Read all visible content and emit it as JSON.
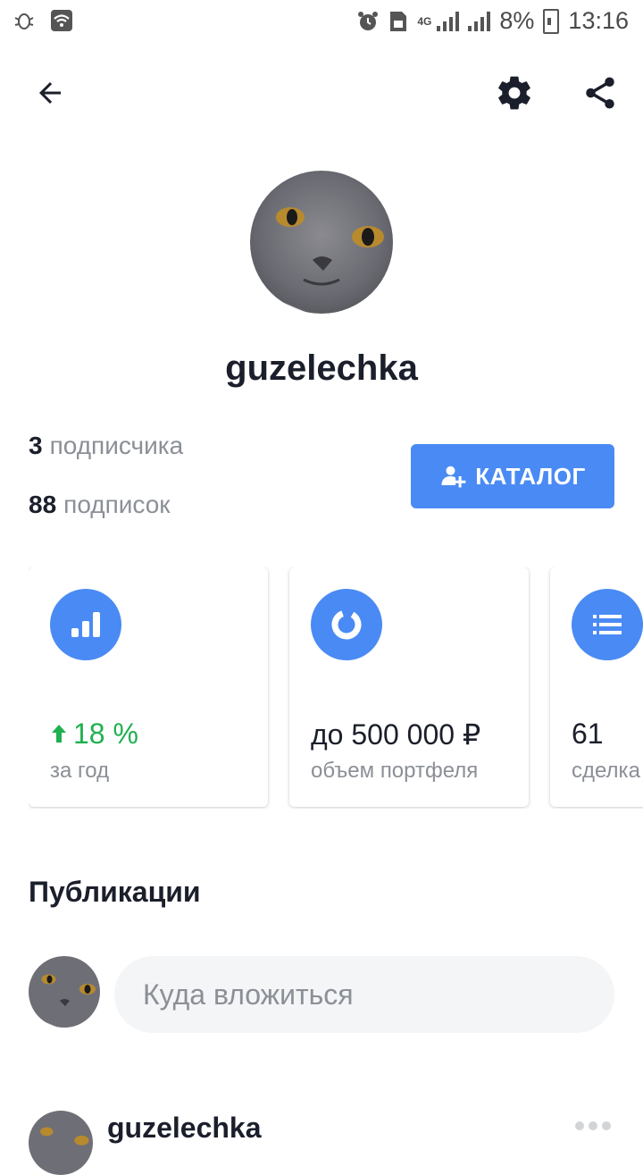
{
  "status_bar": {
    "battery": "8%",
    "time": "13:16",
    "network": "4G",
    "icons": [
      "debug-icon",
      "wifi-icon",
      "alarm-icon",
      "sim-icon",
      "signal-icon",
      "battery-icon"
    ]
  },
  "toolbar": {
    "icons": [
      "back-arrow-icon",
      "gear-icon",
      "share-icon"
    ]
  },
  "profile": {
    "username": "guzelechka",
    "followers_count": "3",
    "followers_label": "подписчика",
    "following_count": "88",
    "following_label": "подписок",
    "catalog_label": "КАТАЛОГ"
  },
  "stats": [
    {
      "icon": "bar-chart-icon",
      "value": "18 %",
      "label": "за год",
      "trend": "up"
    },
    {
      "icon": "donut-chart-icon",
      "value": "до 500 000 ₽",
      "label": "объем портфеля"
    },
    {
      "icon": "list-icon",
      "value": "61",
      "label": "сделка"
    }
  ],
  "publications": {
    "title": "Публикации",
    "input_placeholder": "Куда вложиться",
    "post_author": "guzelechka"
  },
  "colors": {
    "accent": "#4a8af4",
    "positive": "#1fb14f",
    "text_primary": "#1b1f2b",
    "text_secondary": "#8b8f96",
    "input_bg": "#f4f5f7"
  }
}
